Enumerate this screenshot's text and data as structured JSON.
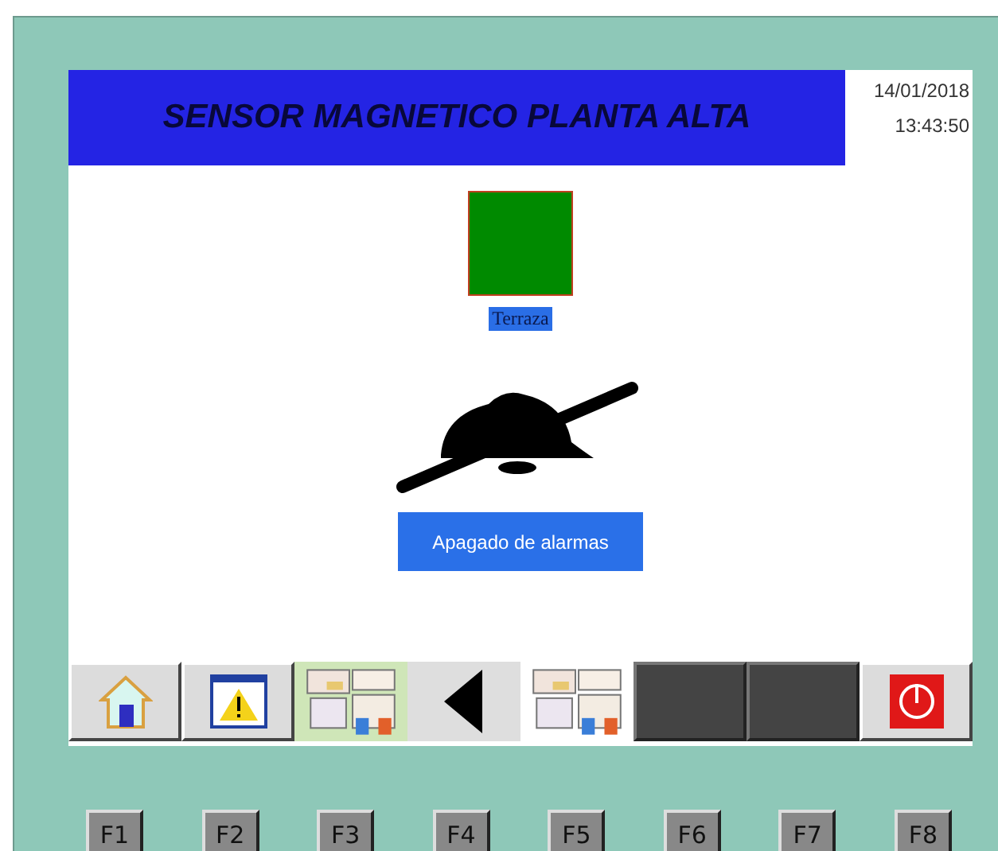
{
  "header": {
    "title": "SENSOR MAGNETICO PLANTA ALTA",
    "date": "14/01/2018",
    "time": "13:43:50"
  },
  "sensors": [
    {
      "label": "Terraza",
      "on": true
    }
  ],
  "alarm": {
    "muted": true,
    "button": "Apagado de alarmas"
  },
  "toolbar": [
    {
      "kind": "home"
    },
    {
      "kind": "alarm"
    },
    {
      "kind": "picture"
    },
    {
      "kind": "back"
    },
    {
      "kind": "picture"
    },
    {
      "kind": "blank"
    },
    {
      "kind": "blank"
    },
    {
      "kind": "power"
    }
  ],
  "function_keys": [
    "F1",
    "F2",
    "F3",
    "F4",
    "F5",
    "F6",
    "F7",
    "F8"
  ]
}
